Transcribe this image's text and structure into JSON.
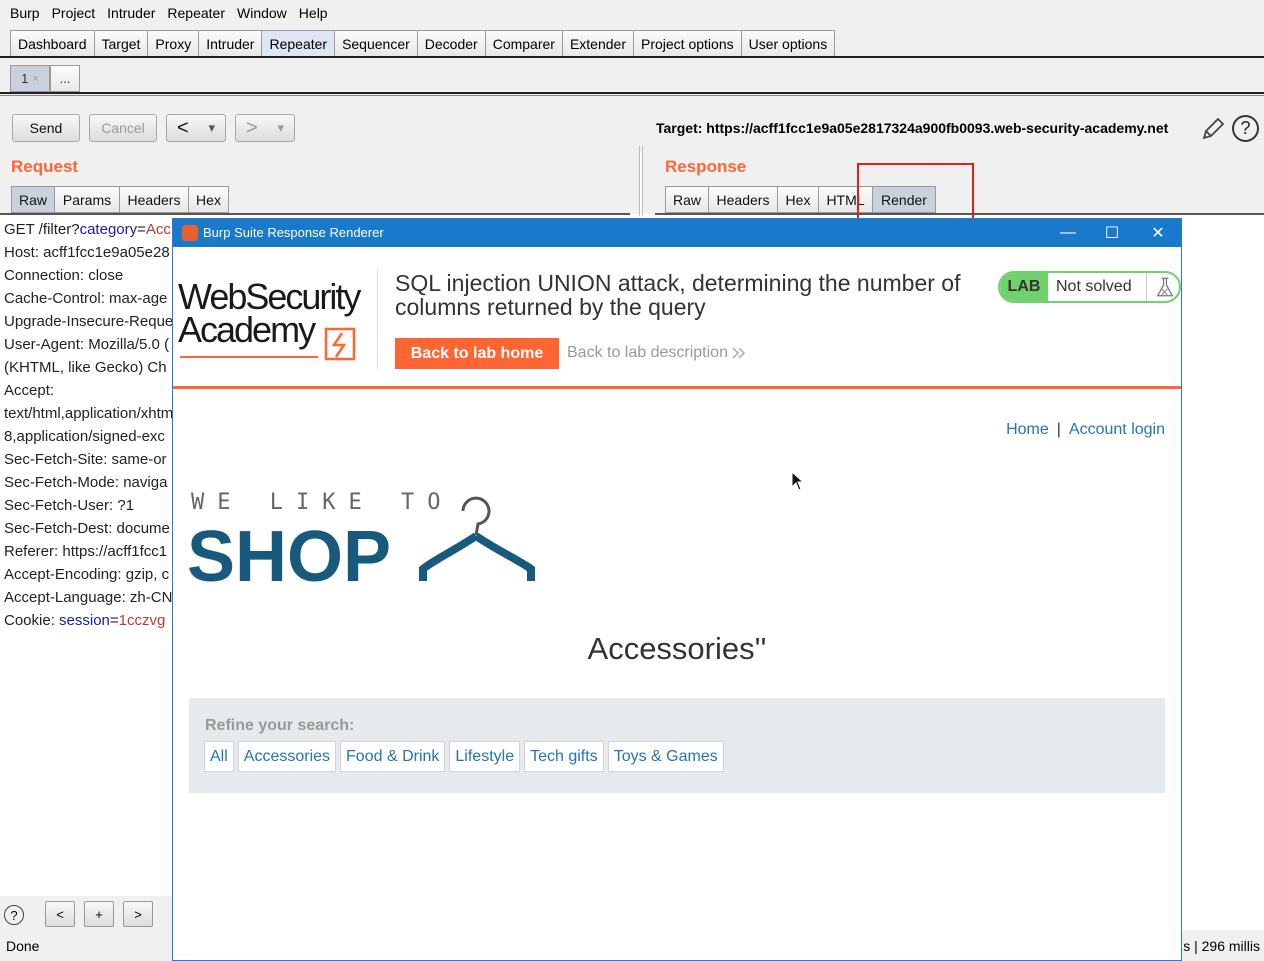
{
  "menu": [
    "Burp",
    "Project",
    "Intruder",
    "Repeater",
    "Window",
    "Help"
  ],
  "main_tabs": [
    "Dashboard",
    "Target",
    "Proxy",
    "Intruder",
    "Repeater",
    "Sequencer",
    "Decoder",
    "Comparer",
    "Extender",
    "Project options",
    "User options"
  ],
  "active_main_tab": "Repeater",
  "sub_tabs": {
    "first": "1",
    "first_close": "×",
    "more": "..."
  },
  "toolbar": {
    "send": "Send",
    "cancel": "Cancel",
    "back": "<",
    "forward": ">",
    "dropdown": "▾",
    "target": "Target: https://acff1fcc1e9a05e2817324a900fb0093.web-security-academy.net",
    "help": "?"
  },
  "request": {
    "title": "Request",
    "tabs": [
      "Raw",
      "Params",
      "Headers",
      "Hex"
    ],
    "lines": [
      {
        "prefix": "GET /filter?",
        "key": "category",
        "eq": "=",
        "val": "Acc"
      },
      {
        "text": "Host: acff1fcc1e9a05e28"
      },
      {
        "text": "Connection: close"
      },
      {
        "text": "Cache-Control: max-age"
      },
      {
        "text": "Upgrade-Insecure-Reque"
      },
      {
        "text": "User-Agent: Mozilla/5.0 ("
      },
      {
        "text": "(KHTML, like Gecko) Ch"
      },
      {
        "text": "Accept:"
      },
      {
        "text": "text/html,application/xhtm"
      },
      {
        "text": "8,application/signed-exc"
      },
      {
        "text": "Sec-Fetch-Site: same-or"
      },
      {
        "text": "Sec-Fetch-Mode: naviga"
      },
      {
        "text": "Sec-Fetch-User: ?1"
      },
      {
        "text": "Sec-Fetch-Dest: docume"
      },
      {
        "text": "Referer: https://acff1fcc1"
      },
      {
        "text": "Accept-Encoding: gzip, c"
      },
      {
        "text": "Accept-Language: zh-CN"
      },
      {
        "prefix": "Cookie: ",
        "key": "session",
        "eq": "=",
        "val": "1cczvg"
      }
    ]
  },
  "response": {
    "title": "Response",
    "tabs": [
      "Raw",
      "Headers",
      "Hex",
      "HTML",
      "Render"
    ],
    "active_tab": "Render"
  },
  "bottom": {
    "help": "?",
    "prev": "<",
    "add": "+",
    "next": ">",
    "status": "Done",
    "timing": "s | 296 millis"
  },
  "renderer": {
    "window_title": "Burp Suite Response Renderer",
    "controls": {
      "minimize": "—",
      "maximize": "☐",
      "close": "✕"
    },
    "academy_logo": {
      "line1": "WebSecurity",
      "line2": "Academy"
    },
    "lab_title": "SQL injection UNION attack, determining the number of columns returned by the query",
    "back_home": "Back to lab home",
    "back_description": "Back to lab description",
    "lab_badge": "LAB",
    "lab_status": "Not solved",
    "nav": {
      "home": "Home",
      "separator": "|",
      "account": "Account login"
    },
    "shop_logo": {
      "tagline": "WE LIKE TO",
      "word": "SHOP"
    },
    "heading": "Accessories''",
    "refine_label": "Refine your search:",
    "filters": [
      "All",
      "Accessories",
      "Food & Drink",
      "Lifestyle",
      "Tech gifts",
      "Toys & Games"
    ]
  },
  "colors": {
    "accent_orange": "#ff6633",
    "link_blue": "#2574b5",
    "lab_green": "#70d16d",
    "titlebar_blue": "#1979ca",
    "highlight_red": "#e02020"
  }
}
